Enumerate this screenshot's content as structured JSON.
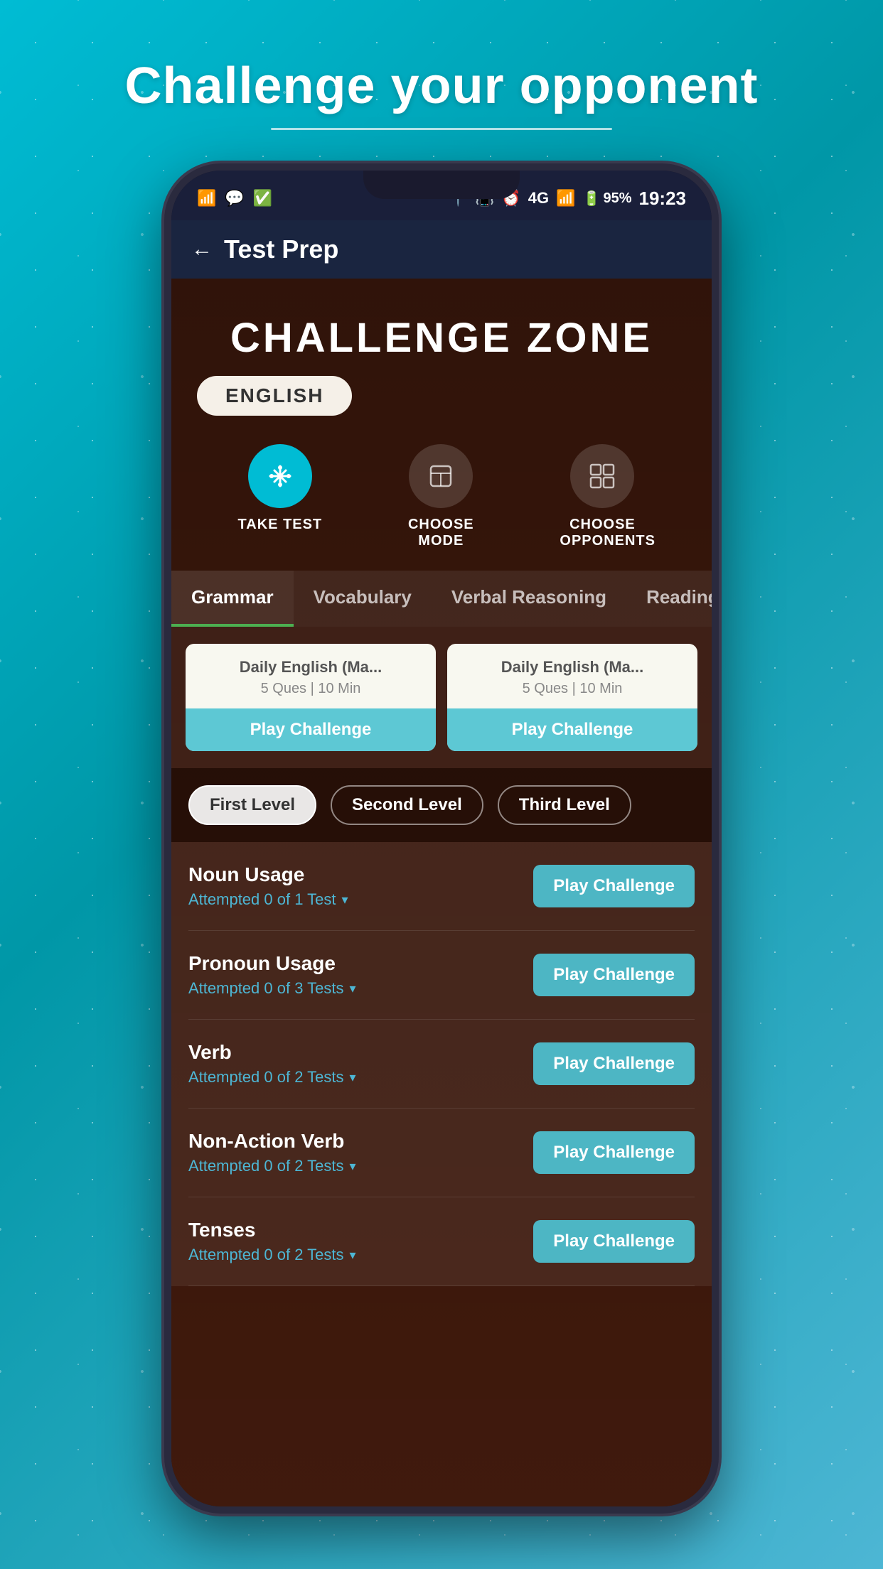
{
  "page": {
    "title": "Challenge your opponent",
    "title_underline": true
  },
  "status_bar": {
    "time": "19:23",
    "battery": "95%",
    "signal": "4G"
  },
  "app_header": {
    "title": "Test Prep",
    "back_label": "←"
  },
  "challenge_zone": {
    "title": "CHALLENGE ZONE",
    "subject_badge": "ENGLISH"
  },
  "mode_icons": [
    {
      "id": "take-test",
      "label": "TAKE TEST",
      "icon": "⚙",
      "active": true
    },
    {
      "id": "choose-mode",
      "label": "CHOOSE MODE",
      "icon": "📄",
      "active": false
    },
    {
      "id": "choose-opponents",
      "label": "CHOOSE OPPONENTS",
      "icon": "⊞",
      "active": false
    }
  ],
  "tabs": [
    {
      "id": "grammar",
      "label": "Grammar",
      "active": true
    },
    {
      "id": "vocabulary",
      "label": "Vocabulary",
      "active": false
    },
    {
      "id": "verbal-reasoning",
      "label": "Verbal Reasoning",
      "active": false
    },
    {
      "id": "reading-comprehension",
      "label": "Reading Compreh...",
      "active": false
    }
  ],
  "daily_cards": [
    {
      "title": "Daily English (Ma...",
      "meta": "5 Ques | 10 Min",
      "btn_label": "Play Challenge"
    },
    {
      "title": "Daily English (Ma...",
      "meta": "5 Ques | 10 Min",
      "btn_label": "Play Challenge"
    }
  ],
  "levels": [
    {
      "id": "first",
      "label": "First Level",
      "active": true
    },
    {
      "id": "second",
      "label": "Second Level",
      "active": false
    },
    {
      "id": "third",
      "label": "Third Level",
      "active": false
    }
  ],
  "topics": [
    {
      "name": "Noun Usage",
      "attempts": "Attempted 0 of 1 Test",
      "btn_label": "Play Challenge"
    },
    {
      "name": "Pronoun Usage",
      "attempts": "Attempted 0 of 3 Tests",
      "btn_label": "Play Challenge"
    },
    {
      "name": "Verb",
      "attempts": "Attempted 0 of 2 Tests",
      "btn_label": "Play Challenge"
    },
    {
      "name": "Non-Action Verb",
      "attempts": "Attempted 0 of 2 Tests",
      "btn_label": "Play Challenge"
    },
    {
      "name": "Tenses",
      "attempts": "Attempted 0 of 2 Tests",
      "btn_label": "Play Challenge"
    }
  ]
}
